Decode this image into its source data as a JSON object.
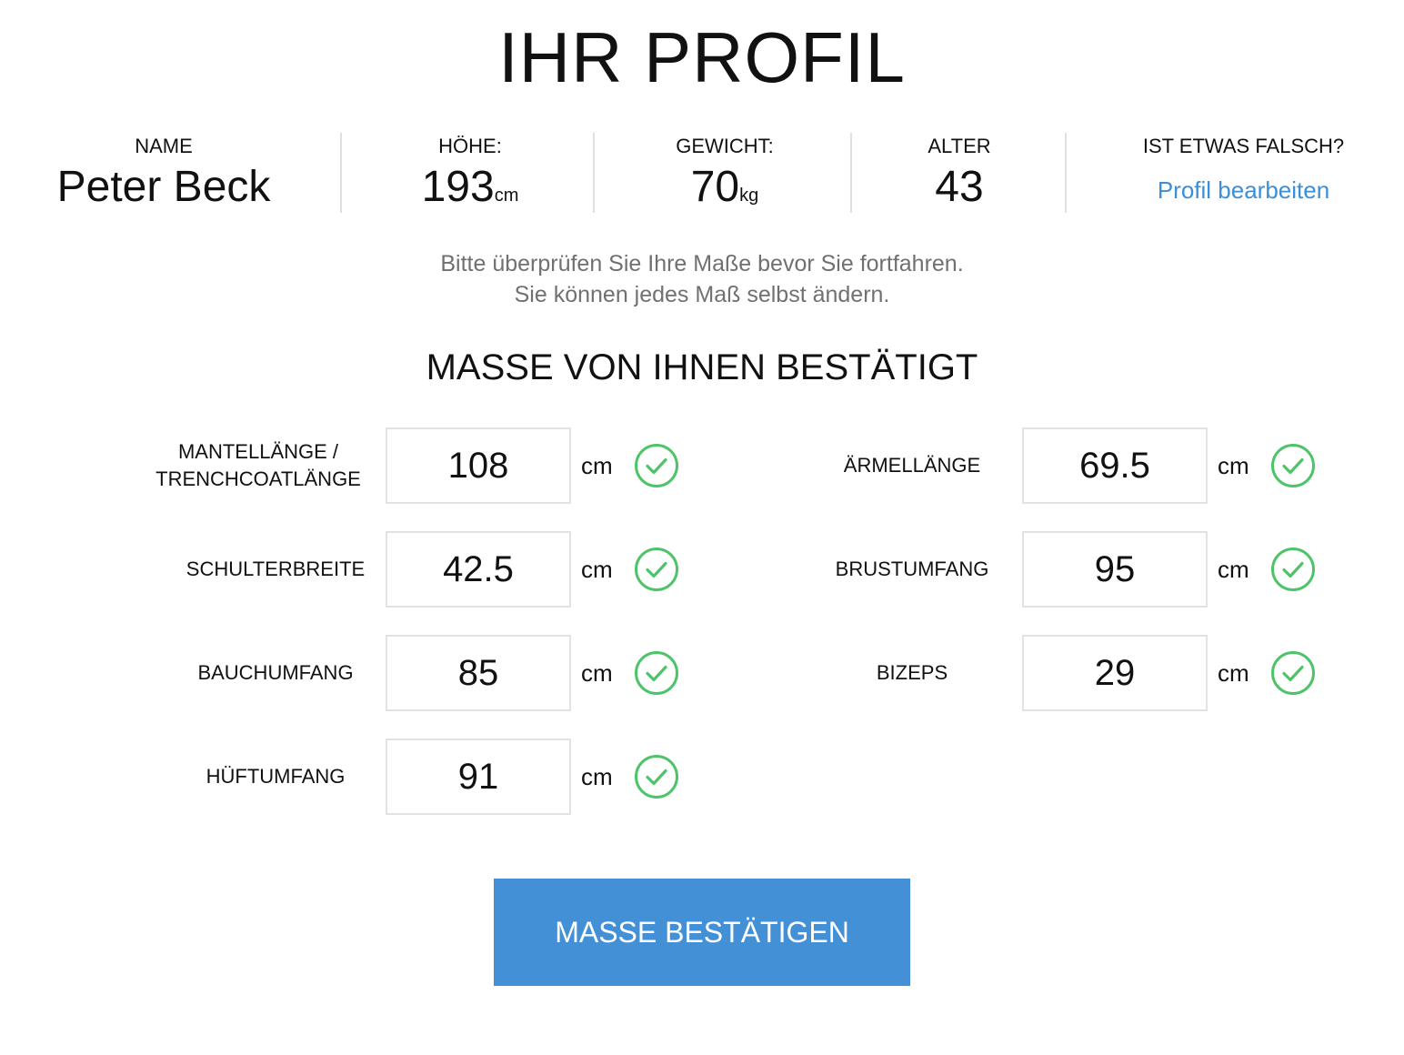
{
  "page": {
    "title": "IHR PROFIL"
  },
  "profile": {
    "name_label": "NAME",
    "name_value": "Peter Beck",
    "height_label": "HÖHE:",
    "height_value": "193",
    "height_unit": "cm",
    "weight_label": "GEWICHT:",
    "weight_value": "70",
    "weight_unit": "kg",
    "age_label": "ALTER",
    "age_value": "43",
    "wrong_label": "IST ETWAS FALSCH?",
    "edit_link": "Profil bearbeiten"
  },
  "hint": {
    "line1": "Bitte überprüfen Sie Ihre Maße bevor Sie fortfahren.",
    "line2": "Sie können jedes Maß selbst ändern."
  },
  "section": {
    "title": "MASSE VON IHNEN BESTÄTIGT"
  },
  "measurements": {
    "left": [
      {
        "label_line1": "MANTELLÄNGE /",
        "label_line2": "TRENCHCOATLÄNGE",
        "value": "108",
        "unit": "cm",
        "status_icon": "check-circle-icon"
      },
      {
        "label": "SCHULTERBREITE",
        "value": "42.5",
        "unit": "cm",
        "status_icon": "check-circle-icon"
      },
      {
        "label": "BAUCHUMFANG",
        "value": "85",
        "unit": "cm",
        "status_icon": "check-circle-icon"
      },
      {
        "label": "HÜFTUMFANG",
        "value": "91",
        "unit": "cm",
        "status_icon": "check-circle-icon"
      }
    ],
    "right": [
      {
        "label": "ÄRMELLÄNGE",
        "value": "69.5",
        "unit": "cm",
        "status_icon": "check-circle-icon"
      },
      {
        "label": "BRUSTUMFANG",
        "value": "95",
        "unit": "cm",
        "status_icon": "check-circle-icon"
      },
      {
        "label": "BIZEPS",
        "value": "29",
        "unit": "cm",
        "status_icon": "check-circle-icon"
      }
    ]
  },
  "actions": {
    "confirm_label": "MASSE BESTÄTIGEN"
  },
  "colors": {
    "accent": "#4390d6",
    "link": "#3b8fd9",
    "check": "#4ec46a",
    "hint_text": "#707070",
    "border": "#e2e2e2"
  }
}
